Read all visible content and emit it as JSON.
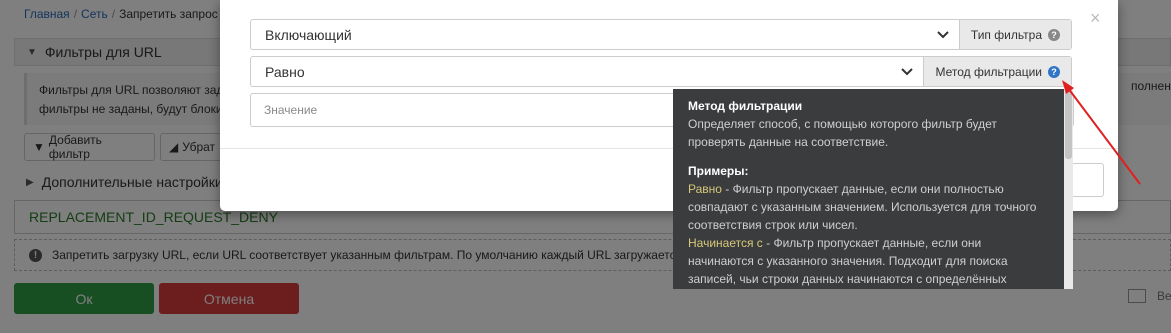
{
  "breadcrumb": {
    "home": "Главная",
    "network": "Сеть",
    "current": "Запретить запрос"
  },
  "section": {
    "title": "Фильтры для URL"
  },
  "info": {
    "line1": "Фильтры для URL позволяют зад",
    "line2": "фильтры не заданы, будут блоки",
    "right": "полнение"
  },
  "toolbar": {
    "add_filter": "Добавить фильтр",
    "remove": "Убрат"
  },
  "extra_settings": {
    "title": "Дополнительные настройки"
  },
  "result_field": {
    "value": "REPLACEMENT_ID_REQUEST_DENY"
  },
  "note": {
    "text": "Запретить загрузку URL, если URL соответствует указанным фильтрам. По умолчанию каждый URL загружается."
  },
  "buttons": {
    "ok": "Ок",
    "cancel": "Отмена",
    "export": "Ве"
  },
  "modal": {
    "close": "×",
    "filter_type": {
      "value": "Включающий",
      "addon": "Тип фильтра"
    },
    "filter_method": {
      "value": "Равно",
      "addon": "Метод фильтрации"
    },
    "value_field": {
      "placeholder": "Значение"
    }
  },
  "tooltip": {
    "title": "Метод фильтрации",
    "description": "Определяет способ, с помощью которого фильтр будет проверять данные на соответствие.",
    "examples_heading": "Примеры:",
    "examples": [
      {
        "term": "Равно",
        "text": " - Фильтр пропускает данные, если они полностью совпадают с указанным значением. Используется для точного соответствия строк или чисел."
      },
      {
        "term": "Начинается с",
        "text": " - Фильтр пропускает данные, если они начинаются с указанного значения. Подходит для поиска записей, чьи строки данных начинаются с определённых"
      }
    ]
  },
  "colors": {
    "ok": "#2e9e47",
    "cancel": "#d93a3a",
    "tooltip_bg": "#3b3c3e",
    "tooltip_term": "#d8c87a",
    "arrow": "#e02020",
    "help_active": "#2f76c7"
  }
}
